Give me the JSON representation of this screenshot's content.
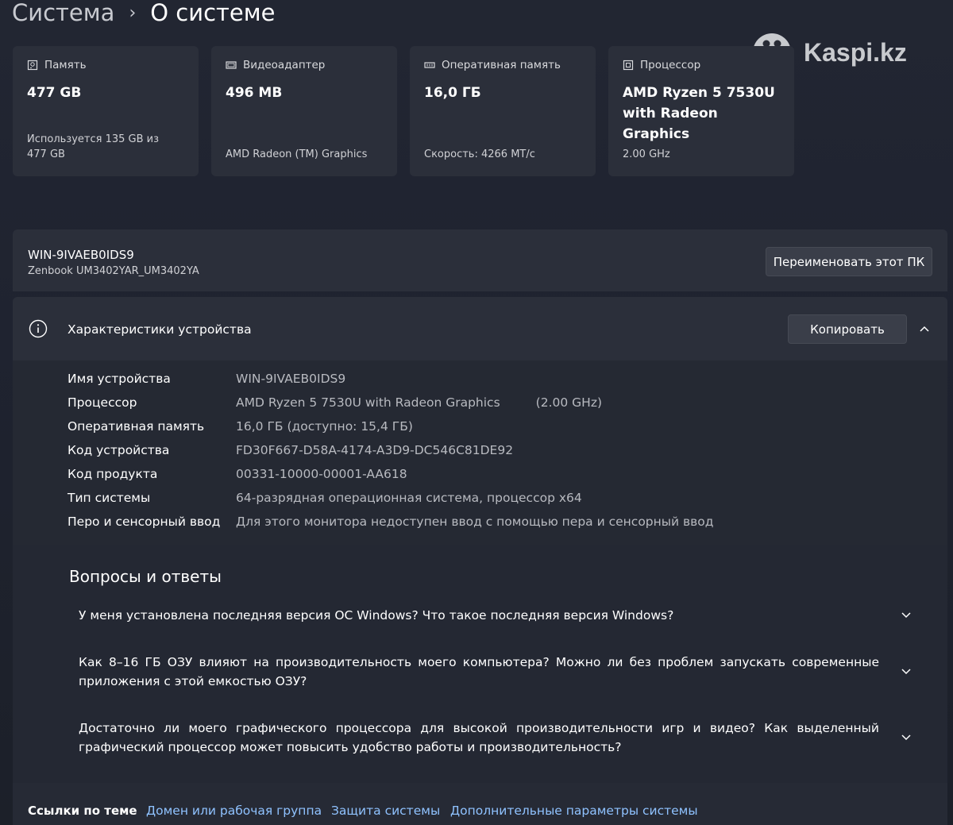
{
  "breadcrumb": {
    "parent": "Система",
    "separator": "›",
    "current": "О системе"
  },
  "watermark": {
    "text": "Kaspi.kz"
  },
  "cards": [
    {
      "title": "Память",
      "value": "477 GB",
      "sub": "Используется 135 GB из 477 GB",
      "icon": "storage-icon"
    },
    {
      "title": "Видеоадаптер",
      "value": "496 MB",
      "sub": "AMD Radeon (TM) Graphics",
      "icon": "display-adapter-icon"
    },
    {
      "title": "Оперативная память",
      "value": "16,0 ГБ",
      "sub": "Скорость: 4266 MT/c",
      "icon": "ram-icon"
    },
    {
      "title": "Процессор",
      "value": "AMD Ryzen 5 7530U with Radeon Graphics",
      "sub": "2.00 GHz",
      "icon": "cpu-icon"
    }
  ],
  "pc": {
    "name": "WIN-9IVAEB0IDS9",
    "model": "Zenbook UM3402YAR_UM3402YA",
    "rename_label": "Переименовать этот ПК"
  },
  "specs": {
    "title": "Характеристики устройства",
    "copy_label": "Копировать",
    "rows": [
      {
        "label": "Имя устройства",
        "value": "WIN-9IVAEB0IDS9"
      },
      {
        "label": "Процессор",
        "value": "AMD Ryzen 5 7530U with Radeon Graphics",
        "extra": "(2.00 GHz)"
      },
      {
        "label": "Оперативная память",
        "value": "16,0 ГБ (доступно: 15,4 ГБ)"
      },
      {
        "label": "Код устройства",
        "value": "FD30F667-D58A-4174-A3D9-DC546C81DE92"
      },
      {
        "label": "Код продукта",
        "value": "00331-10000-00001-AA618"
      },
      {
        "label": "Тип системы",
        "value": "64-разрядная операционная система, процессор x64"
      },
      {
        "label": "Перо и сенсорный ввод",
        "value": "Для этого монитора недоступен ввод с помощью пера и сенсорный ввод"
      }
    ]
  },
  "faq": {
    "title": "Вопросы и ответы",
    "items": [
      "У меня установлена последняя версия ОС Windows? Что такое последняя версия Windows?",
      "Как 8–16 ГБ ОЗУ влияют на производительность моего компьютера? Можно ли без проблем запускать современные приложения с этой емкостью ОЗУ?",
      "Достаточно ли моего графического процессора для высокой производительности игр и видео? Как выделенный графический процессор может повысить удобство работы и производительность?"
    ]
  },
  "links": {
    "label": "Ссылки по теме",
    "items": [
      "Домен или рабочая группа",
      "Защита системы",
      "Дополнительные параметры системы"
    ]
  },
  "colors": {
    "background": "#202430",
    "card": "#2b2f3a",
    "link": "#8fc2ff",
    "button": "#3a3e49"
  }
}
